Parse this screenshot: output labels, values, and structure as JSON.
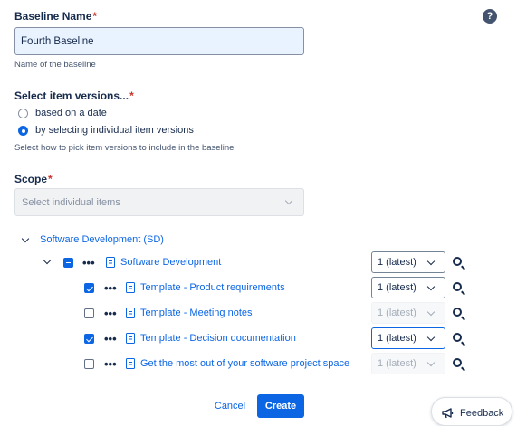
{
  "baseline_name": {
    "label": "Baseline Name",
    "required_mark": "*",
    "value": "Fourth Baseline",
    "helper": "Name of the baseline"
  },
  "item_versions": {
    "label": "Select item versions...",
    "required_mark": "*",
    "options": [
      {
        "label": "based on a date",
        "selected": false
      },
      {
        "label": "by selecting individual item versions",
        "selected": true
      }
    ],
    "helper": "Select how to pick item versions to include in the baseline"
  },
  "scope": {
    "label": "Scope",
    "required_mark": "*",
    "placeholder": "Select individual items"
  },
  "tree": {
    "root": {
      "label": "Software Development (SD)",
      "expanded": true
    },
    "parent": {
      "label": "Software Development",
      "check_state": "indeterminate",
      "version": "1 (latest)",
      "version_state": "enabled"
    },
    "children": [
      {
        "label": "Template - Product requirements",
        "checked": true,
        "version": "1 (latest)",
        "version_state": "enabled"
      },
      {
        "label": "Template - Meeting notes",
        "checked": false,
        "version": "1 (latest)",
        "version_state": "disabled"
      },
      {
        "label": "Template - Decision documentation",
        "checked": true,
        "version": "1 (latest)",
        "version_state": "focused"
      },
      {
        "label": "Get the most out of your software project space",
        "checked": false,
        "version": "1 (latest)",
        "version_state": "disabled"
      }
    ],
    "more_actions_glyph": "•••"
  },
  "actions": {
    "cancel": "Cancel",
    "create": "Create"
  },
  "help_icon_glyph": "?",
  "feedback": {
    "label": "Feedback",
    "icon": "megaphone-icon"
  },
  "colors": {
    "accent": "#0c66e4",
    "text": "#172b4d",
    "required": "#c9372c",
    "input_bg": "#e9f2ff"
  }
}
